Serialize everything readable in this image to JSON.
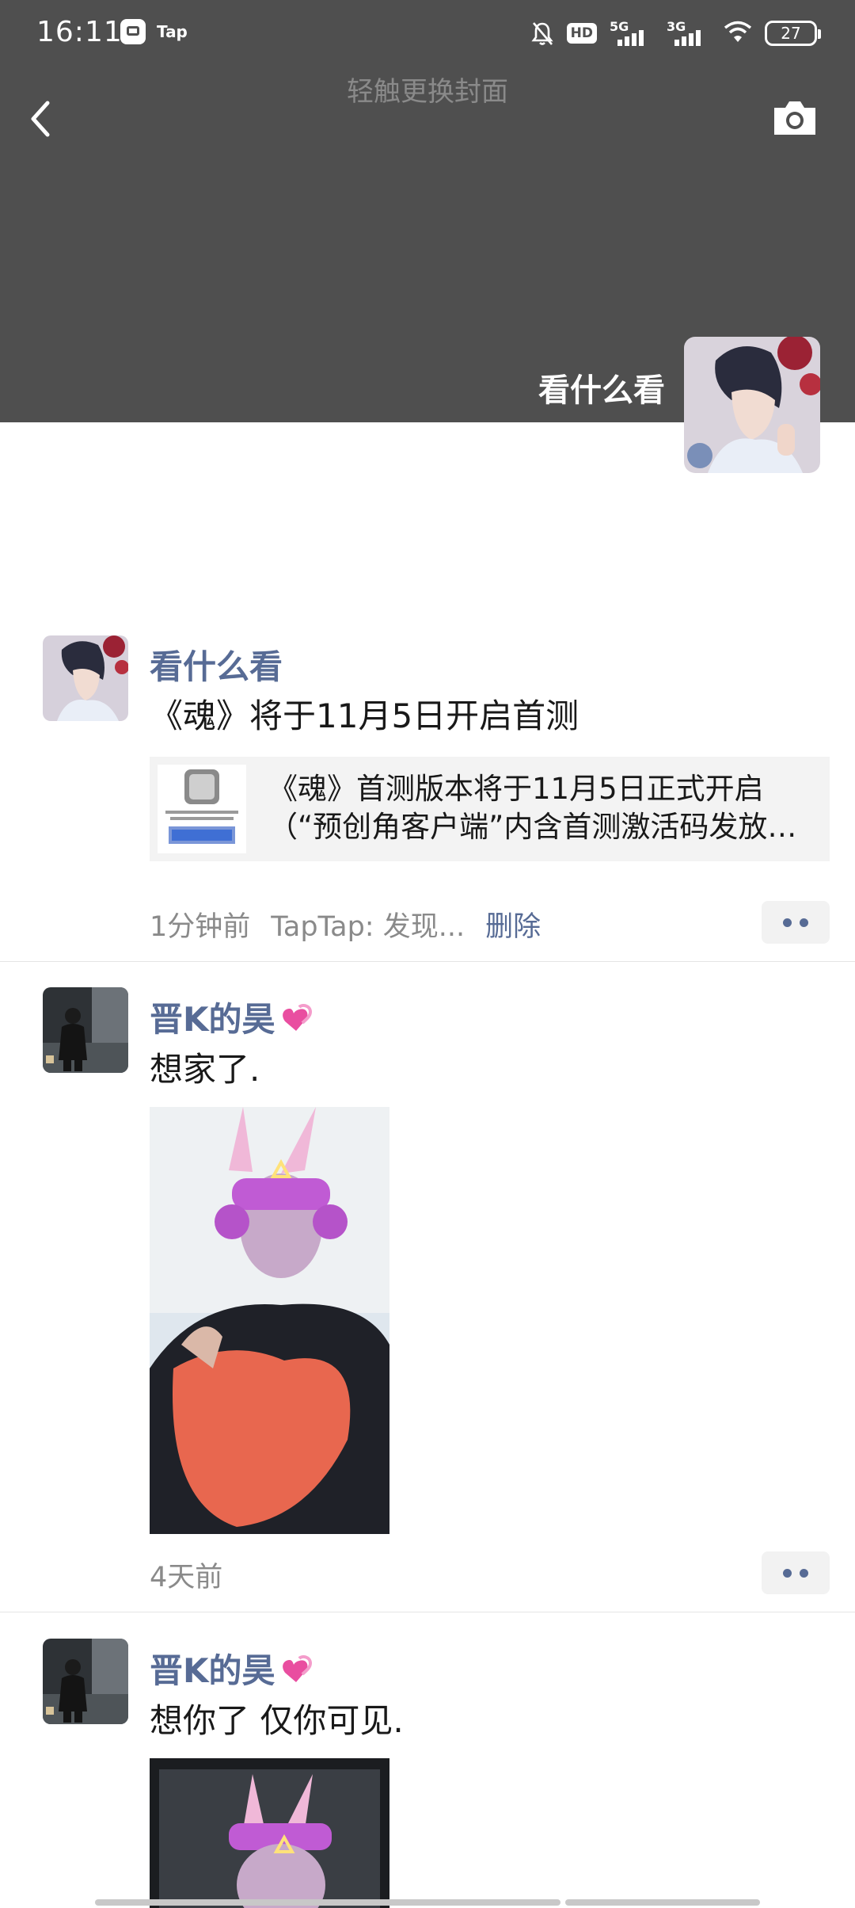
{
  "status_bar": {
    "time": "16:11",
    "app_label": "Tap",
    "hd_label": "HD",
    "network_1": "5G",
    "network_2": "3G",
    "battery": "27"
  },
  "header": {
    "cover_hint": "轻触更换封面",
    "profile_name": "看什么看"
  },
  "posts": [
    {
      "name": "看什么看",
      "text": "《魂》将于11月5日开启首测",
      "link": {
        "line1": "《魂》首测版本将于11月5日正式开启",
        "line2": "（“预创角客户端”内含首测激活码发放…"
      },
      "time": "1分钟前",
      "source": "TapTap: 发现...",
      "delete_label": "删除"
    },
    {
      "name": "晋K的昊",
      "text": "想家了.",
      "time": "4天前"
    },
    {
      "name": "晋K的昊",
      "text": "想你了 仅你可见."
    }
  ],
  "icons": [
    "back-arrow-icon",
    "camera-icon",
    "notification-off-icon",
    "wifi-icon",
    "battery-icon",
    "more-dots-icon",
    "heart-emoji-icon"
  ],
  "colors": {
    "cover_bg": "#4f4f4f",
    "name_blue": "#576b95",
    "meta_gray": "#8a8a8a",
    "card_bg": "#f3f3f3"
  }
}
